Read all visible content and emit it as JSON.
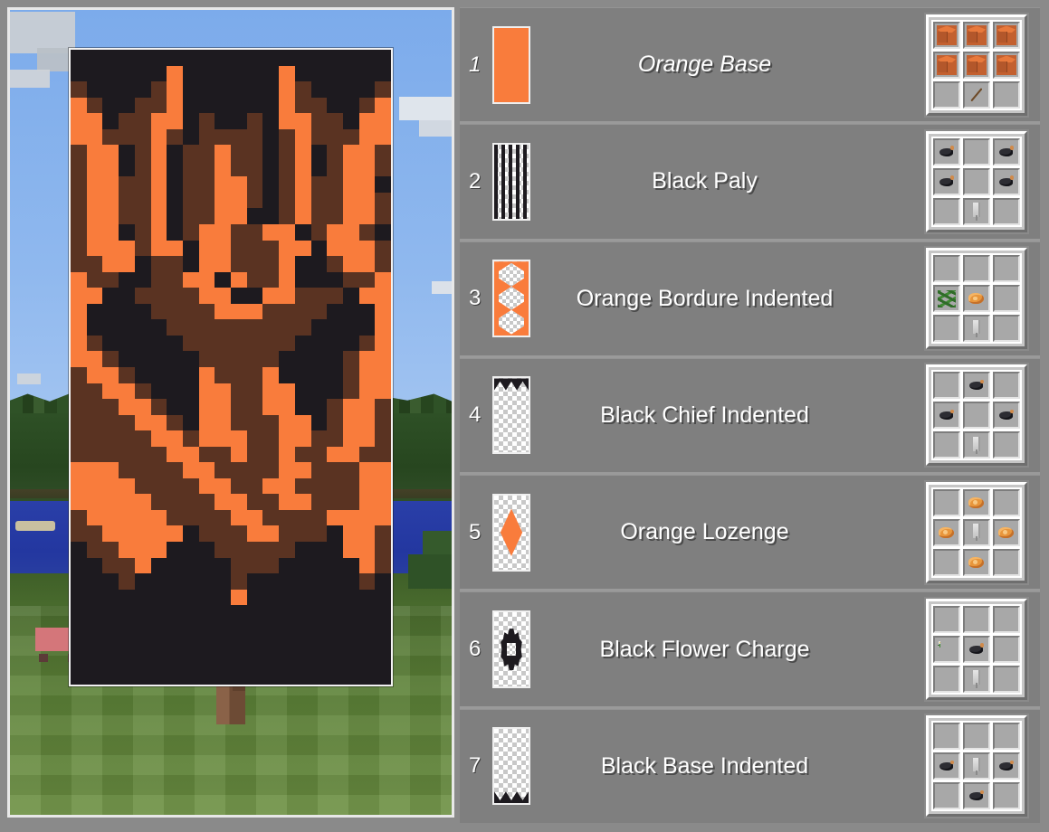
{
  "preview": {
    "scene_name": "minecraft-world-background",
    "banner_name": "crafted-banner-preview",
    "colors": {
      "orange": "#F97C3C",
      "brown": "#5A3322",
      "black": "#1D1A1F",
      "sky": "#7CABEB",
      "grass": "#5B7C36",
      "water": "#2A3FA8",
      "post": "#8A6248"
    },
    "banner_grid": {
      "cols": 20,
      "rows": 40,
      "legend": {
        "o": "#F97C3C",
        "r": "#5A3322",
        "k": "#1D1A1F"
      },
      "pixels": [
        "kkkkkkkkkkkkkkkkkkkk",
        "kkkkkkokkkkkkokkkkkk",
        "rkkkkrokkkkkkorkkkkr",
        "orkkrrokkkkkkorrkkro",
        "ookrrookrkkrkoorrkoo",
        "oorrrorkrrrrkrorrroo",
        "rookrokrrorrkrokroor",
        "rookrokrrorrkrokroor",
        "roorrokrroorkrorrooy",
        "roorrokrroorkrorroor",
        "roorrokrrookkrorroor",
        "rookrokroorrookroor",
        "rooorookoorrrookooor",
        "rrookrrkoorrrokkroor",
        "orrkkrrookorrokkkrro",
        "ookkrrrrookkoorrrkoo",
        "okkkkrrrrooorrrrkkko",
        "okkkkkrrrrrrrrrkkkko",
        "orkkkkkrrrrrrrkkkkro",
        "oorkkkkkrrrrrkkkkroo",
        "roorkkkkorrrokkkkroo",
        "rroorkkkoorrookkkroor",
        "rrroorkkoorrookkroorr",
        "rrrroorkoorrrookroorr",
        "rrrrroorooorroorroorr",
        "rrrrrroorrorrorroorrr",
        "ooorrrroorrrroorrrooo",
        "oooorrrroorroorrrrooo",
        "ooooorrrroorroorrrooo",
        "rooooorrrroorrrroooor",
        "rroooookrrroorrrkoorr",
        "krroookkkrrrrrkkkoorr",
        "kkrrokkkkkrrrkkkkkork",
        "kkkrkkkkkkrkkkkkkkrkk",
        "kkkkkkkkkkokkkkkkkkkk",
        "kkkkkkkkkkkkkkkkkkkk",
        "kkkkkkkkkkkkkkkkkkkk",
        "kkkkkkkkkkkkkkkkkkkk",
        "kkkkkkkkkkkkkkkkkkkk",
        "kkkkkkkkkkkkkkkkkkkk"
      ]
    }
  },
  "recipes": {
    "rows": [
      {
        "index": "1",
        "label": "Orange Base",
        "italic": true,
        "pattern_icon": "orange-base-pattern",
        "craft_grid": [
          "wool-orange",
          "wool-orange",
          "wool-orange",
          "wool-orange",
          "wool-orange",
          "wool-orange",
          "empty",
          "stick",
          "empty"
        ]
      },
      {
        "index": "2",
        "label": "Black Paly",
        "italic": false,
        "pattern_icon": "black-paly-pattern",
        "craft_grid": [
          "dye-black",
          "empty",
          "dye-black",
          "dye-black",
          "empty",
          "dye-black",
          "empty",
          "banner-item",
          "empty"
        ]
      },
      {
        "index": "3",
        "label": "Orange Bordure Indented",
        "italic": false,
        "pattern_icon": "orange-bordure-indented-pattern",
        "craft_grid": [
          "empty",
          "empty",
          "empty",
          "vine",
          "dye-orange",
          "empty",
          "empty",
          "banner-item",
          "empty"
        ]
      },
      {
        "index": "4",
        "label": "Black Chief Indented",
        "italic": false,
        "pattern_icon": "black-chief-indented-pattern",
        "craft_grid": [
          "empty",
          "dye-black",
          "empty",
          "dye-black",
          "empty",
          "dye-black",
          "empty",
          "banner-item",
          "empty"
        ]
      },
      {
        "index": "5",
        "label": "Orange Lozenge",
        "italic": false,
        "pattern_icon": "orange-lozenge-pattern",
        "craft_grid": [
          "empty",
          "dye-orange",
          "empty",
          "dye-orange",
          "banner-item",
          "dye-orange",
          "empty",
          "dye-orange",
          "empty"
        ]
      },
      {
        "index": "6",
        "label": "Black Flower Charge",
        "italic": false,
        "pattern_icon": "black-flower-charge-pattern",
        "craft_grid": [
          "empty",
          "empty",
          "empty",
          "flower",
          "dye-black",
          "empty",
          "empty",
          "banner-item",
          "empty"
        ]
      },
      {
        "index": "7",
        "label": "Black Base Indented",
        "italic": false,
        "pattern_icon": "black-base-indented-pattern",
        "craft_grid": [
          "empty",
          "empty",
          "empty",
          "dye-black",
          "banner-item",
          "dye-black",
          "empty",
          "dye-black",
          "empty"
        ]
      }
    ]
  }
}
